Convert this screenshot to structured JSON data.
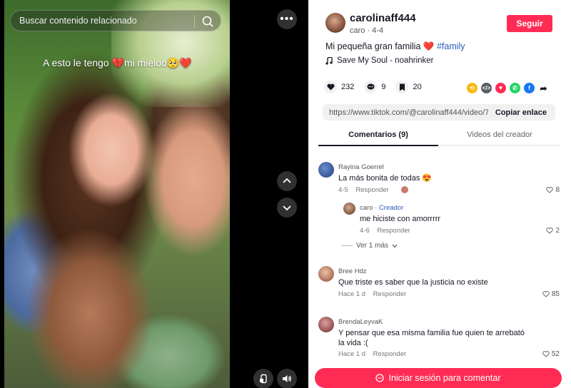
{
  "video": {
    "search_placeholder": "Buscar contenido relacionado",
    "overlay_caption": "A esto le tengo 💔mi mieloo🥺❤️",
    "more_label": "•••"
  },
  "post": {
    "username": "carolinaff444",
    "subline": "caro · 4-4",
    "follow_label": "Seguir",
    "description": "Mi pequeña gran familia ❤️",
    "hashtag": "#family",
    "music": "Save My Soul - noahrinker",
    "stats": {
      "likes": "232",
      "comments": "9",
      "saves": "20"
    },
    "link": "https://www.tiktok.com/@carolinaff444/video/762...",
    "copy_label": "Copiar enlace"
  },
  "tabs": {
    "comments": "Comentarios (9)",
    "videos": "Videos del creador"
  },
  "comments": [
    {
      "name": "Rayina Goerrel",
      "text": "La más bonita de todas 😍",
      "date": "4-5",
      "reply": "Responder",
      "likes": "8"
    },
    {
      "name": "caro",
      "creator": "Creador",
      "text": "me hiciste con amorrrrr",
      "date": "4-6",
      "reply": "Responder",
      "likes": "2"
    },
    {
      "name": "Bree Hdz",
      "text": "Que triste es saber que la justicia no existe",
      "date": "Hace 1 d",
      "reply": "Responder",
      "likes": "85"
    },
    {
      "name": "BrendaLeyvaK",
      "text": "Y pensar que esa misma familia fue quien te arrebató la vida :(",
      "date": "Hace 1 d",
      "reply": "Responder",
      "likes": "52"
    }
  ],
  "more_replies": "Ver 1 más",
  "login_label": "Iniciar sesión para comentar",
  "colors": {
    "accent": "#fe2c55",
    "link": "#2b5db9"
  },
  "share_icons": [
    "embed-icon",
    "code-icon",
    "send-icon",
    "whatsapp-icon",
    "facebook-icon",
    "share-arrow-icon"
  ]
}
